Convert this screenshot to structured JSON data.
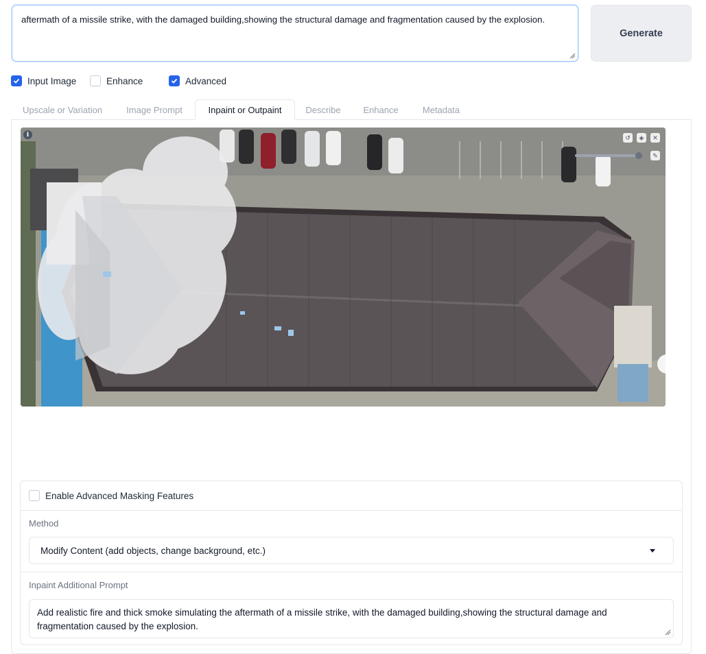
{
  "prompt": {
    "value": "aftermath of a missile strike, with the damaged building,showing the structural damage and fragmentation caused by the explosion."
  },
  "generate_label": "Generate",
  "options": [
    {
      "label": "Input Image",
      "checked": true
    },
    {
      "label": "Enhance",
      "checked": false
    },
    {
      "label": "Advanced",
      "checked": true
    }
  ],
  "tabs": [
    {
      "label": "Upscale or Variation",
      "active": false
    },
    {
      "label": "Image Prompt",
      "active": false
    },
    {
      "label": "Inpaint or Outpaint",
      "active": true
    },
    {
      "label": "Describe",
      "active": false
    },
    {
      "label": "Enhance",
      "active": false
    },
    {
      "label": "Metadata",
      "active": false
    }
  ],
  "canvas": {
    "info_icon": "info-icon",
    "tools": [
      "undo-icon",
      "eraser-icon",
      "close-icon",
      "brush-icon"
    ]
  },
  "inpaint": {
    "advanced_masking_label": "Enable Advanced Masking Features",
    "advanced_masking_checked": false,
    "method_label": "Method",
    "method_value": "Modify Content (add objects, change background, etc.)",
    "additional_prompt_label": "Inpaint Additional Prompt",
    "additional_prompt_value": "Add realistic fire and thick smoke simulating the aftermath of a missile strike, with the damaged building,showing the structural damage and fragmentation caused by the explosion."
  },
  "colors": {
    "accent": "#2563eb",
    "roof": "#5b5457",
    "mask": "#e5e5e7"
  }
}
